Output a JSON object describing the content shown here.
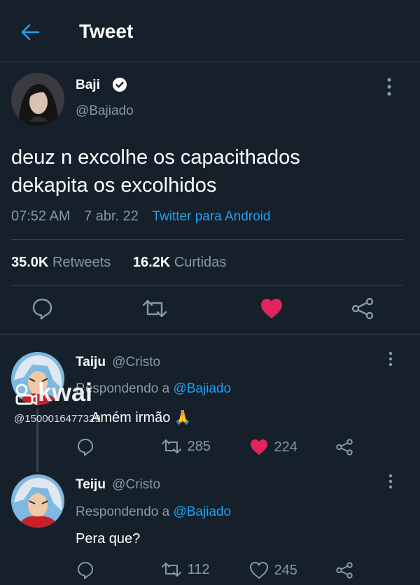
{
  "header": {
    "title": "Tweet"
  },
  "main_tweet": {
    "author_name": "Baji",
    "author_handle": "@Bajiado",
    "text_line1": "deuz n excolhe os capacithados",
    "text_line2": "dekapita os excolhidos",
    "time": "07:52 AM",
    "date": "7 abr. 22",
    "source": "Twitter para Android",
    "retweets_count": "35.0K",
    "retweets_label": "Retweets",
    "likes_count": "16.2K",
    "likes_label": "Curtidas"
  },
  "replies": [
    {
      "author_name": "Taiju",
      "author_handle": "@Cristo",
      "replying_prefix": "Respondendo a",
      "replying_to": "@Bajiado",
      "text": "Amém irmão 🙏",
      "retweets": "285",
      "likes": "224",
      "liked": true
    },
    {
      "author_name": "Teiju",
      "author_handle": "@Cristo",
      "replying_prefix": "Respondendo a",
      "replying_to": "@Bajiado",
      "text": "Pera que?",
      "retweets": "112",
      "likes": "245",
      "liked": false
    }
  ],
  "watermark": {
    "brand": "kwai",
    "id": "@1500016477329"
  },
  "colors": {
    "background": "#15202b",
    "accent": "#1da1f2",
    "like": "#e0245e",
    "muted": "#8899a6",
    "divider": "#38444d"
  },
  "icons": [
    "back-arrow-icon",
    "verified-icon",
    "more-icon",
    "reply-icon",
    "retweet-icon",
    "like-icon",
    "share-icon"
  ]
}
